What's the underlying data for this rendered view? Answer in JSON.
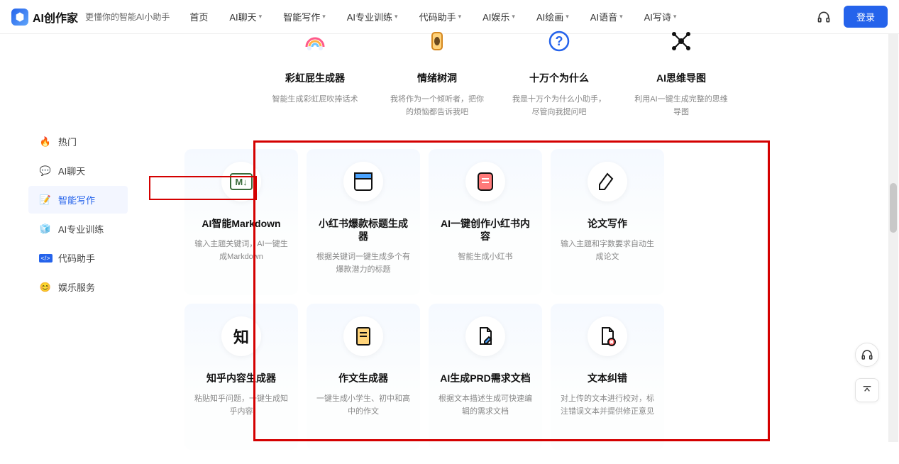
{
  "header": {
    "logo_text": "AI创作家",
    "tagline": "更懂你的智能AI小助手",
    "nav": [
      {
        "label": "首页",
        "dropdown": false
      },
      {
        "label": "AI聊天",
        "dropdown": true
      },
      {
        "label": "智能写作",
        "dropdown": true
      },
      {
        "label": "AI专业训练",
        "dropdown": true
      },
      {
        "label": "代码助手",
        "dropdown": true
      },
      {
        "label": "AI娱乐",
        "dropdown": true
      },
      {
        "label": "AI绘画",
        "dropdown": true
      },
      {
        "label": "AI语音",
        "dropdown": true
      },
      {
        "label": "AI写诗",
        "dropdown": true
      }
    ],
    "login": "登录"
  },
  "sidebar": {
    "items": [
      {
        "label": "热门",
        "icon": "flame",
        "color": "#ff7a00"
      },
      {
        "label": "AI聊天",
        "icon": "chat",
        "color": "#34c759"
      },
      {
        "label": "智能写作",
        "icon": "edit",
        "color": "#2563eb",
        "active": true
      },
      {
        "label": "AI专业训练",
        "icon": "cube",
        "color": "#7c7c7c"
      },
      {
        "label": "代码助手",
        "icon": "code",
        "color": "#2563eb"
      },
      {
        "label": "娱乐服务",
        "icon": "smile",
        "color": "#2563eb"
      }
    ]
  },
  "top_cards": [
    {
      "title": "彩虹屁生成器",
      "desc": "智能生成彩虹屁吹捧话术",
      "icon": "rainbow"
    },
    {
      "title": "情绪树洞",
      "desc": "我将作为一个倾听者，把你的烦恼都告诉我吧",
      "icon": "treehole"
    },
    {
      "title": "十万个为什么",
      "desc": "我是十万个为什么小助手，尽管向我提问吧",
      "icon": "question"
    },
    {
      "title": "AI思维导图",
      "desc": "利用AI一键生成完整的思维导图",
      "icon": "mindmap"
    }
  ],
  "cards": [
    {
      "title": "AI智能Markdown",
      "desc": "输入主题关键词，AI一键生成Markdown",
      "icon": "markdown"
    },
    {
      "title": "小红书爆款标题生成器",
      "desc": "根据关键词一键生成多个有爆款潜力的标题",
      "icon": "window"
    },
    {
      "title": "AI一键创作小红书内容",
      "desc": "智能生成小红书",
      "icon": "note"
    },
    {
      "title": "论文写作",
      "desc": "输入主题和字数要求自动生成论文",
      "icon": "pen"
    },
    {
      "title": "知乎内容生成器",
      "desc": "粘贴知乎问题，一键生成知乎内容",
      "icon": "zhihu"
    },
    {
      "title": "作文生成器",
      "desc": "一键生成小学生、初中和高中的作文",
      "icon": "essay"
    },
    {
      "title": "AI生成PRD需求文档",
      "desc": "根据文本描述生成可快速编辑的需求文档",
      "icon": "doc-edit"
    },
    {
      "title": "文本纠错",
      "desc": "对上传的文本进行校对，标注错误文本并提供修正意见",
      "icon": "doc-error"
    }
  ]
}
